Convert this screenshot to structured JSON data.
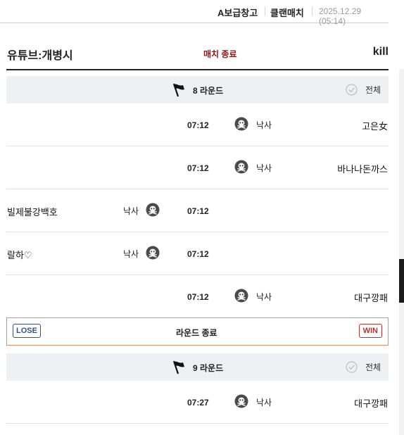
{
  "topbar": {
    "warehouse": "A보급창고",
    "clan_match": "클랜매치",
    "datetime": "2025.12.29 (05:14)"
  },
  "header": {
    "left_title": "유튜브:개병시",
    "status": "매치 종료",
    "right_title": "kill"
  },
  "rounds": [
    {
      "title": "8 라운드",
      "all_label": "전체",
      "events": [
        {
          "time": "07:12",
          "type": "낙사",
          "side": "right",
          "player": "고은女"
        },
        {
          "time": "07:12",
          "type": "낙사",
          "side": "right",
          "player": "바나나돈까스"
        },
        {
          "time": "07:12",
          "type": "낙사",
          "side": "left",
          "player": "빌제불강백호"
        },
        {
          "time": "07:12",
          "type": "낙사",
          "side": "left",
          "player": "랄하♡"
        },
        {
          "time": "07:12",
          "type": "낙사",
          "side": "right",
          "player": "대구깡패"
        }
      ],
      "result": {
        "left": "LOSE",
        "label": "라운드 종료",
        "right": "WIN"
      }
    },
    {
      "title": "9 라운드",
      "all_label": "전체",
      "events": [
        {
          "time": "07:27",
          "type": "낙사",
          "side": "right",
          "player": "대구깡패"
        }
      ]
    }
  ],
  "icons": {
    "round": "flag-icon",
    "filter": "check-circle-icon",
    "death": "skull-icon"
  },
  "colors": {
    "status": "#8a1a1a",
    "lose": "#3a4d8f",
    "win": "#b83232",
    "round_bg": "#eef0f3",
    "end_border": "#d99072"
  }
}
